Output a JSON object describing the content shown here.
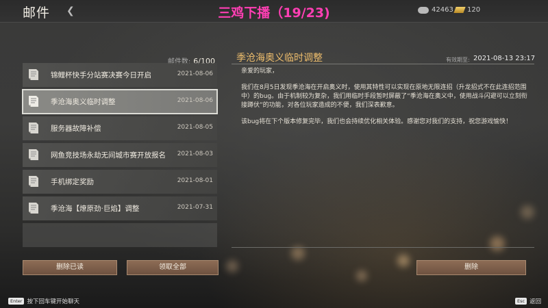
{
  "header": {
    "title": "邮件",
    "stream_title": "三鸡下播（19/23)",
    "silver": "42463",
    "gold": "120"
  },
  "mail_count": {
    "label": "邮件数:",
    "value": "6/100"
  },
  "mails": [
    {
      "title": "锦鲤杯快手分站赛决赛今日开启",
      "date": "2021-08-06"
    },
    {
      "title": "季沧海奥义临时调整",
      "date": "2021-08-06"
    },
    {
      "title": "服务器故障补偿",
      "date": "2021-08-05"
    },
    {
      "title": "网鱼竞技场永劫无间城市赛开放报名",
      "date": "2021-08-03"
    },
    {
      "title": "手机绑定奖励",
      "date": "2021-08-01"
    },
    {
      "title": "季沧海【燎原劲·巨焰】调整",
      "date": "2021-07-31"
    }
  ],
  "detail": {
    "title": "季沧海奥义临时调整",
    "expire_label": "有效期至:",
    "expire_date": "2021-08-13 23:17",
    "greeting": "亲爱的玩家，",
    "para1": "我们在8月5日发现季沧海在开启奥义时，使用其特性可以实现在原地无限连招（升龙招式不在此连招范围中）的bug。由于机制较为复杂，我们用临时手段暂时屏蔽了“季沧海在奥义中，使用战斗闪避可以立刻衔接蹲伏”的功能，对各位玩家造成的不便，我们深表歉意。",
    "para2": "该bug将在下个版本修复完毕，我们也会持续优化相关体验。感谢您对我们的支持，祝您游戏愉快！"
  },
  "buttons": {
    "delete_read": "删除已读",
    "claim_all": "领取全部",
    "delete": "删除"
  },
  "hints": {
    "enter_key": "Enter",
    "enter_text": "按下回车键开始聊天",
    "esc_key": "Esc",
    "esc_text": "返回"
  },
  "colors": {
    "accent_title": "#efbe6d",
    "stream_pink": "#ff3fb4",
    "button": "#7d5f4a"
  },
  "icons": {
    "back": "chevron-left-icon",
    "mail": "scroll-icon",
    "silver": "silver-coin-icon",
    "gold": "gold-ingot-icon"
  }
}
